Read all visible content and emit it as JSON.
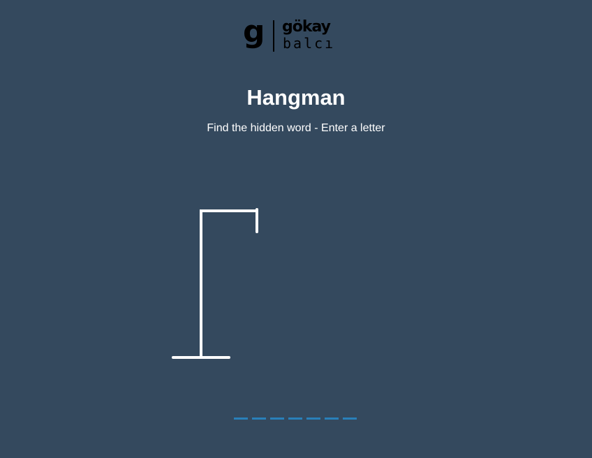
{
  "logo": {
    "mark": "g",
    "top": "gökay",
    "bottom": "balcı"
  },
  "game": {
    "title": "Hangman",
    "subtitle": "Find the hidden word - Enter a letter",
    "word_length": 7,
    "revealed": [
      "",
      "",
      "",
      "",
      "",
      "",
      ""
    ]
  },
  "colors": {
    "background": "#34495e",
    "gallows": "#ffffff",
    "slot": "#2980b9"
  }
}
